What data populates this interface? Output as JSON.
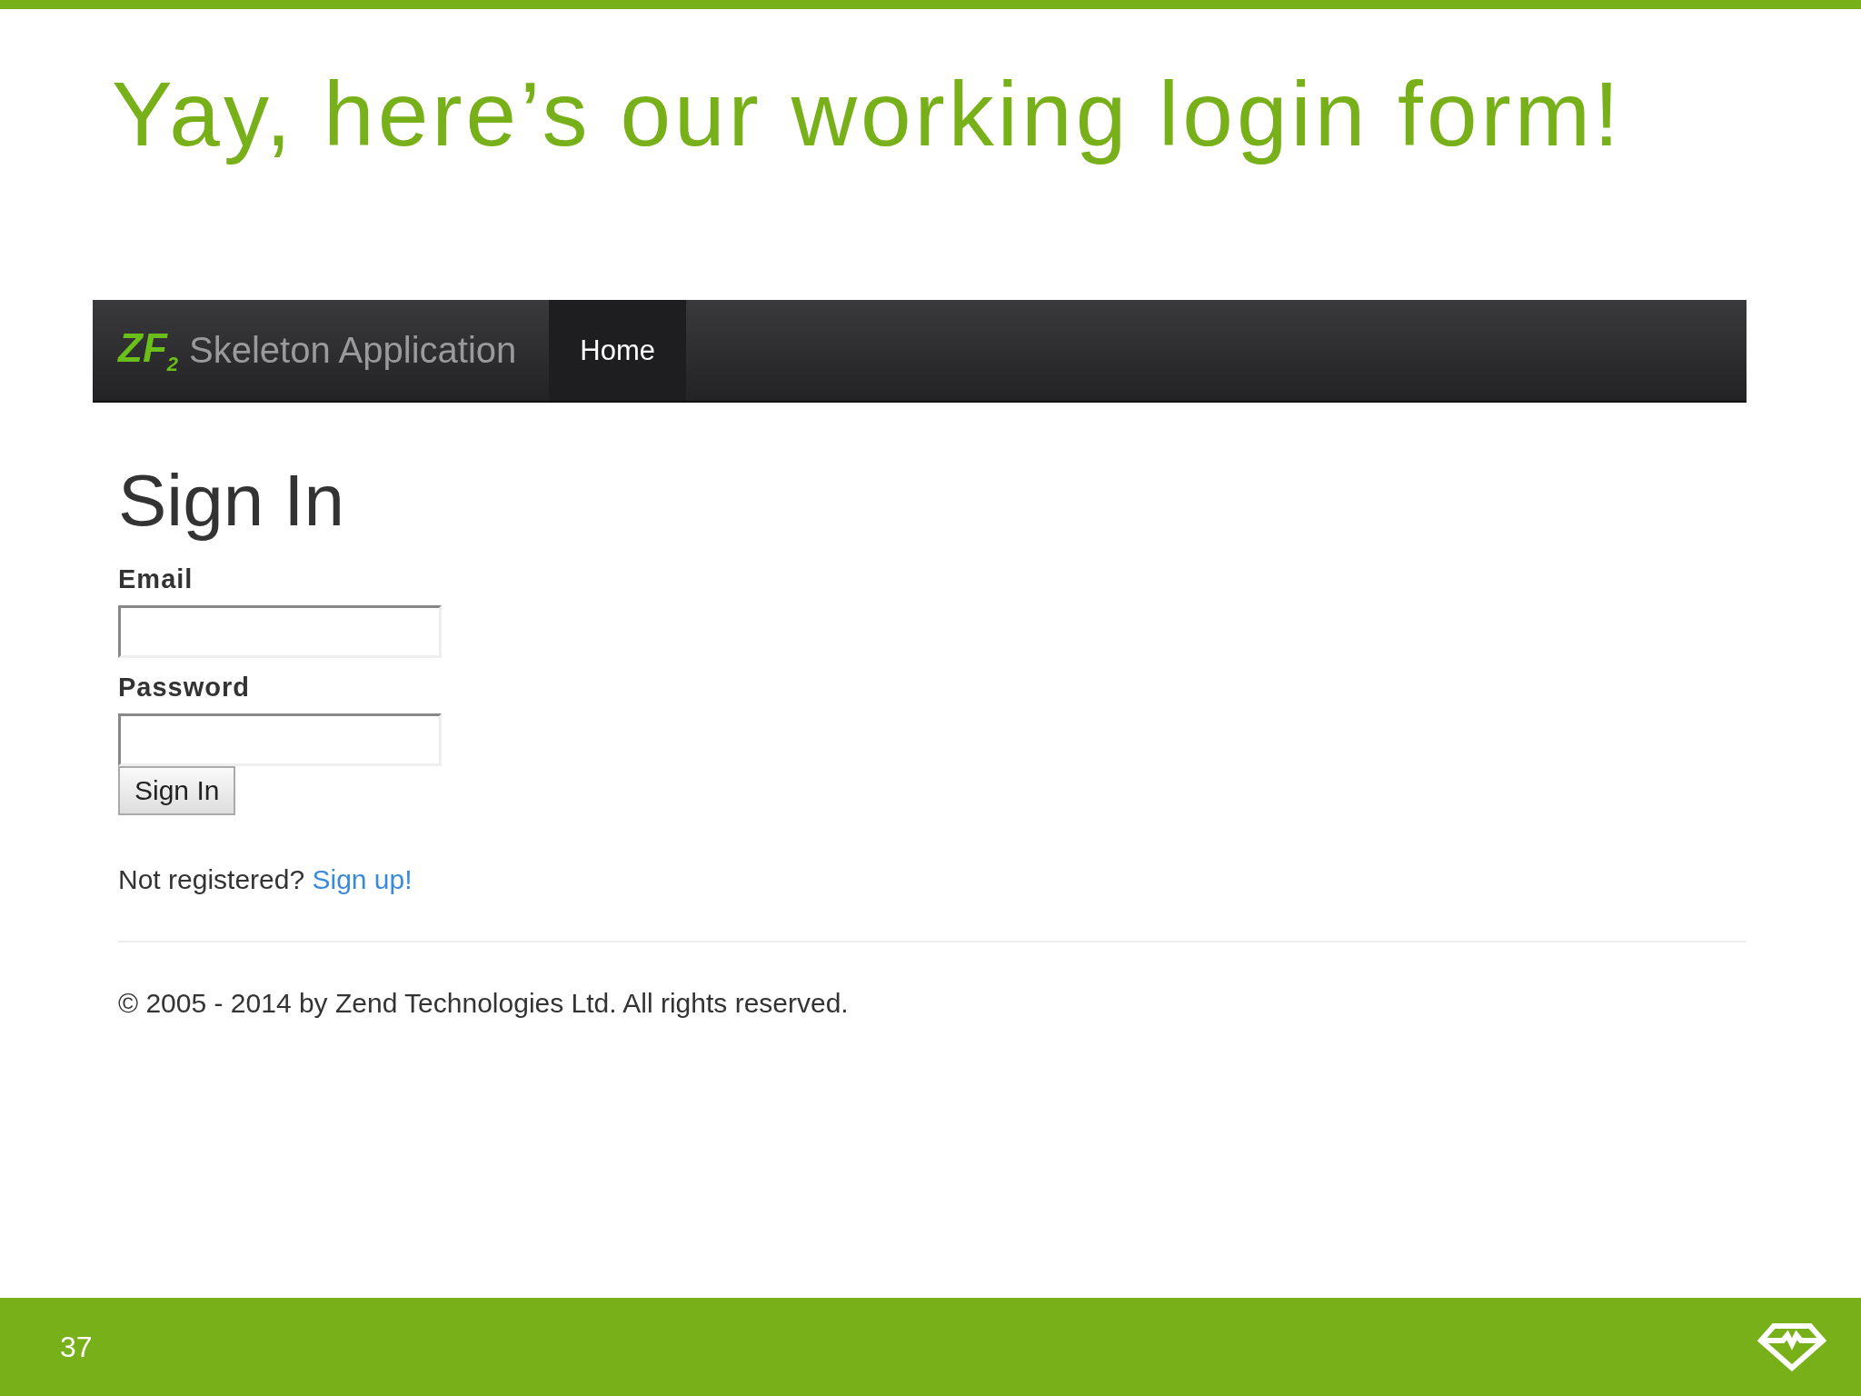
{
  "slide": {
    "title": "Yay, here’s our working login form!",
    "page_number": "37"
  },
  "navbar": {
    "logo": "ZF$_{2}$",
    "brand": "Skeleton Application",
    "items": [
      {
        "label": "Home",
        "selected": true
      }
    ]
  },
  "form": {
    "heading": "Sign In",
    "fields": [
      {
        "label": "Email"
      },
      {
        "label": "Password"
      }
    ],
    "submit": "Sign In"
  },
  "register": {
    "text": "Not registered?",
    "link": "Sign up!"
  },
  "footer": {
    "copyright": "© 2005 - 2014 by Zend Technologies Ltd. All rights reserved."
  }
}
